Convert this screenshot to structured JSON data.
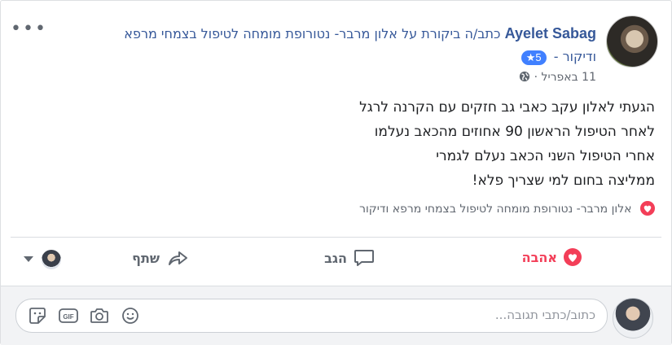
{
  "post": {
    "author": "Ayelet Sabag",
    "header_text": "כתב/ה ביקורת על אלון מרבר- נטורופת מומחה לטיפול בצמחי מרפא",
    "header_text_2": "ודיקור",
    "rating": "5",
    "timestamp": "11 באפריל",
    "dot": "·",
    "more_label": "•••",
    "body_lines": [
      "הגעתי לאלון עקב כאבי גב חזקים עם הקרנה לרגל",
      "לאחר הטיפול הראשון 90 אחוזים מהכאב נעלמו",
      "אחרי הטיפול השני הכאב נעלם לגמרי",
      "ממליצה בחום למי שצריך פלא!"
    ],
    "reactions_text": "אלון מרבר- נטורופת מומחה לטיפול בצמחי מרפא ודיקור"
  },
  "actions": {
    "love": "אהבה",
    "comment": "הגב",
    "share": "שתף"
  },
  "comment": {
    "placeholder": "כתוב/כתבי תגובה..."
  },
  "colors": {
    "link": "#365899",
    "love": "#f33e58",
    "badge": "#4080ff"
  }
}
